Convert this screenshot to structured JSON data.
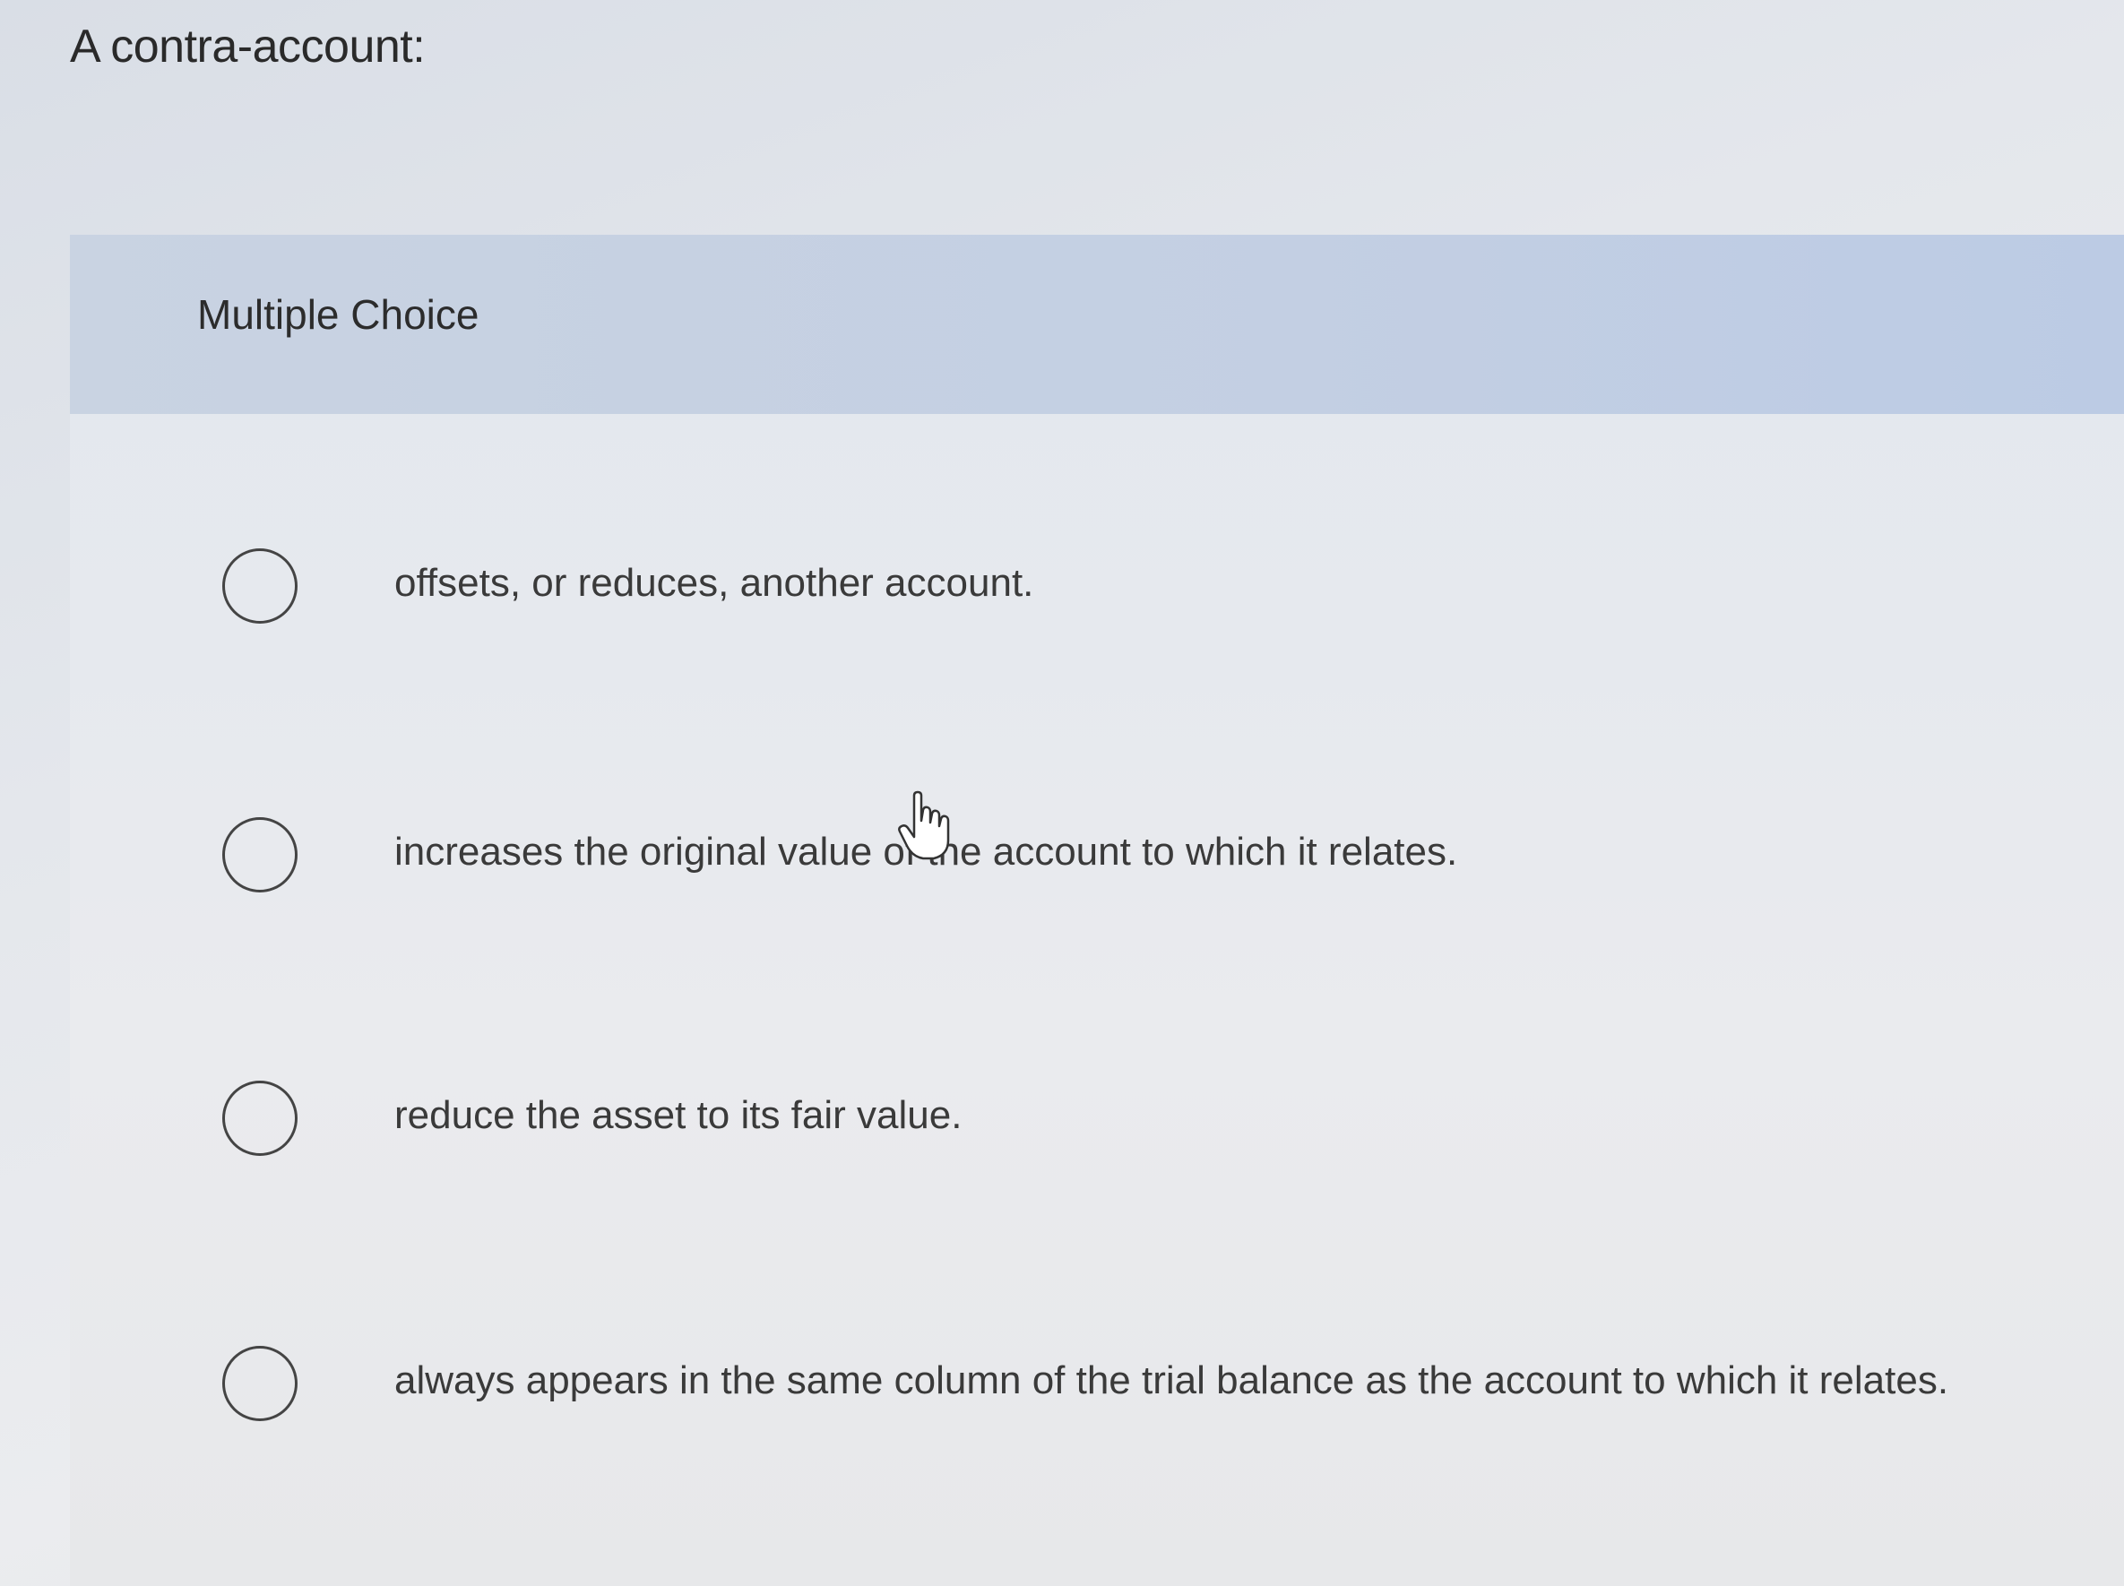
{
  "question": {
    "title": "A contra-account:"
  },
  "multiple_choice": {
    "header_label": "Multiple Choice",
    "options": [
      {
        "label": "offsets, or reduces, another account."
      },
      {
        "label": "increases the original value of the account to which it relates."
      },
      {
        "label": "reduce the asset to its fair value."
      },
      {
        "label": "always appears in the same column of the trial balance as the account to which it relates."
      }
    ]
  },
  "icons": {
    "cursor": "hand-pointer-icon"
  }
}
